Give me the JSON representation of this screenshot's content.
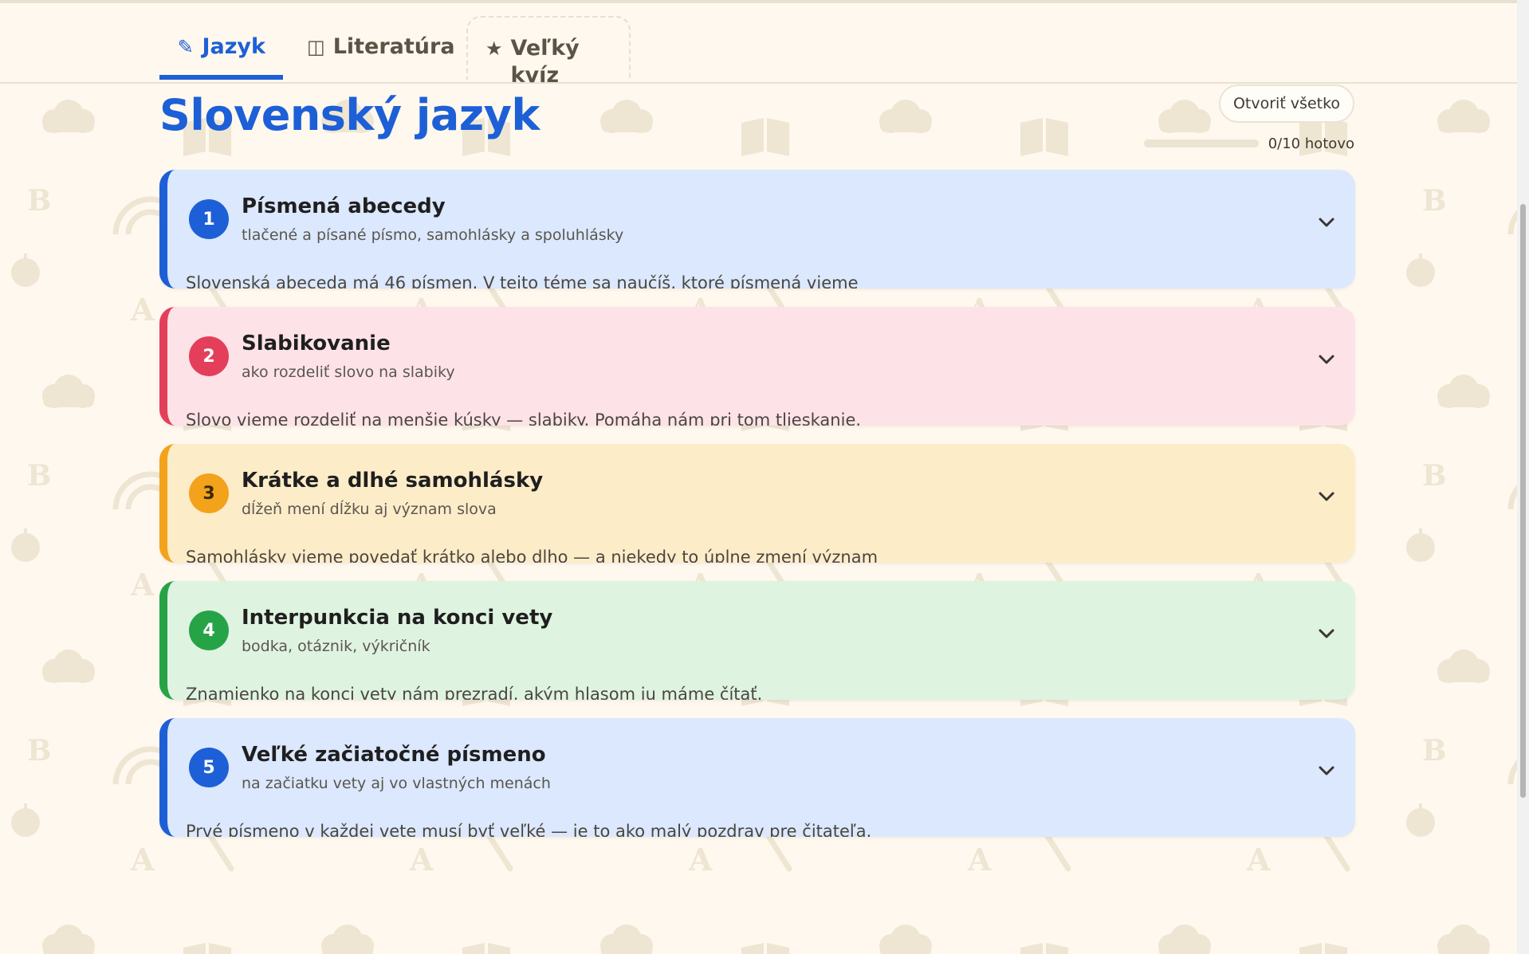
{
  "tabs": [
    {
      "label": "Jazyk",
      "icon": "pencil-icon",
      "glyph": "✎",
      "active": true
    },
    {
      "label": "Literatúra",
      "icon": "book-icon",
      "glyph": "◫",
      "active": false
    },
    {
      "label": "Veľký kvíz",
      "icon": "star-icon",
      "glyph": "★",
      "active": false
    }
  ],
  "page": {
    "title": "Slovenský jazyk",
    "open_all_label": "Otvoriť všetko",
    "progress": {
      "done": 0,
      "total": 10,
      "text": "0/10 hotovo",
      "fraction": 0
    }
  },
  "topics": [
    {
      "number": "1",
      "title": "Písmená abecedy",
      "subtitle": "tlačené a písané písmo, samohlásky a spoluhlásky",
      "description": "Slovenská abeceda má 46 písmen. V tejto téme sa naučíš, ktoré písmená vieme",
      "color": "#1d5fd6",
      "bg": "#dbe8fd"
    },
    {
      "number": "2",
      "title": "Slabikovanie",
      "subtitle": "ako rozdeliť slovo na slabiky",
      "description": "Slovo vieme rozdeliť na menšie kúsky — slabiky. Pomáha nám pri tom tlieskanie.",
      "color": "#e43f5a",
      "bg": "#fde3e8"
    },
    {
      "number": "3",
      "title": "Krátke a dlhé samohlásky",
      "subtitle": "dĺžeň mení dĺžku aj význam slova",
      "description": "Samohlásky vieme povedať krátko alebo dlho — a niekedy to úplne zmení význam",
      "color": "#f2a31b",
      "bg": "#fdecc8"
    },
    {
      "number": "4",
      "title": "Interpunkcia na konci vety",
      "subtitle": "bodka, otáznik, výkričník",
      "description": "Znamienko na konci vety nám prezradí, akým hlasom ju máme čítať.",
      "color": "#27a347",
      "bg": "#dff3e1"
    },
    {
      "number": "5",
      "title": "Veľké začiatočné písmeno",
      "subtitle": "na začiatku vety aj vo vlastných menách",
      "description": "Prvé písmeno v každej vete musí byť veľké — je to ako malý pozdrav pre čitateľa.",
      "color": "#1d5fd6",
      "bg": "#dbe8fd"
    }
  ]
}
